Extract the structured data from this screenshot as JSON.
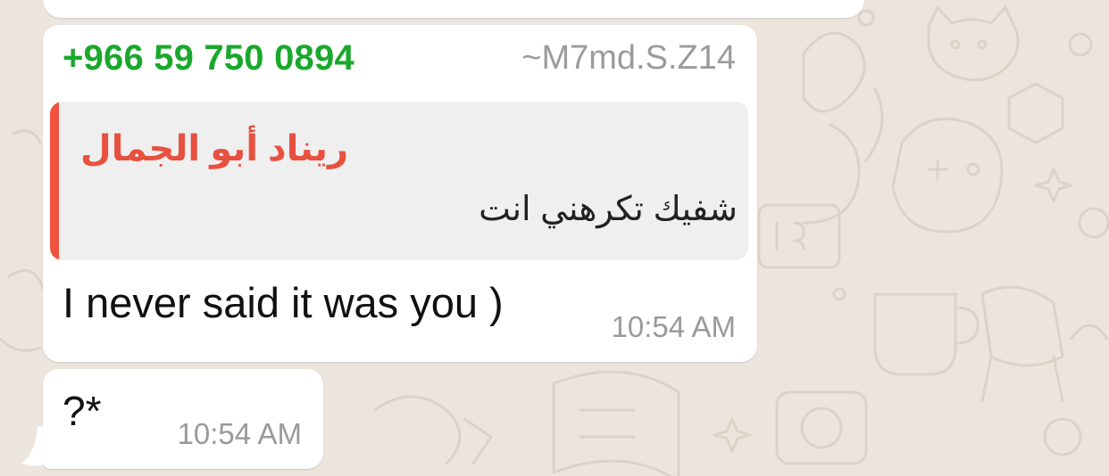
{
  "chat": {
    "messages": [
      {
        "sender_phone": "+966 59 750 0894",
        "sender_name": "~M7md.S.Z14",
        "quote": {
          "author": "ريناد أبو الجمال",
          "text": "شفيك تكرهني انت"
        },
        "text": "I never said it was you )",
        "time": "10:54 AM"
      },
      {
        "text": "?*",
        "time": "10:54 AM"
      }
    ]
  },
  "colors": {
    "background": "#ece5dd",
    "bubble": "#ffffff",
    "sender_phone": "#1aa82c",
    "quote_accent": "#f0533d",
    "quote_author": "#e8513f",
    "quote_background": "#efefef",
    "timestamp": "#9a9a9a"
  }
}
